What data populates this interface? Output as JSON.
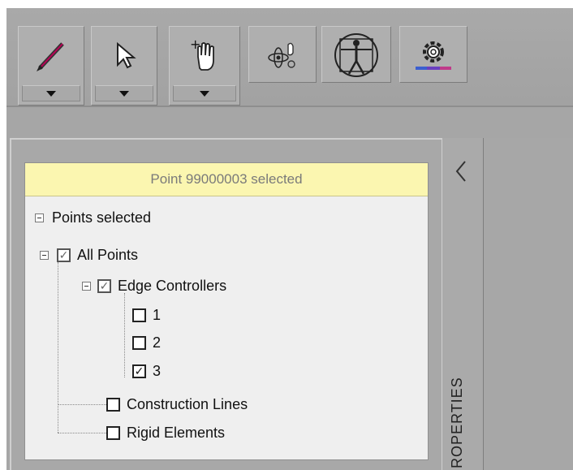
{
  "toolbar": {
    "tools": [
      {
        "icon": "pencil-icon",
        "has_dropdown": true
      },
      {
        "icon": "arrow-pointer-icon",
        "has_dropdown": true
      },
      {
        "icon": "hand-plus-icon",
        "has_dropdown": true
      },
      {
        "icon": "atom-hand-icon",
        "has_dropdown": false
      },
      {
        "icon": "vitruvian-man-icon",
        "has_dropdown": false
      },
      {
        "icon": "gear-icon",
        "has_dropdown": false
      }
    ]
  },
  "panel": {
    "status_text": "Point 99000003 selected",
    "side_tab_label": "PROPERTIES",
    "tree": {
      "root_label": "Points selected",
      "all_points": {
        "label": "All Points",
        "checked": true
      },
      "edge_controllers": {
        "label": "Edge Controllers",
        "checked": true
      },
      "items": [
        {
          "label": "1",
          "checked": false
        },
        {
          "label": "2",
          "checked": false
        },
        {
          "label": "3",
          "checked": true
        }
      ],
      "construction_lines": {
        "label": "Construction Lines",
        "checked": false
      },
      "rigid_elements": {
        "label": "Rigid Elements",
        "checked": false
      }
    }
  },
  "colors": {
    "status_bg": "#fbf6b0",
    "panel_bg": "#efefef",
    "chrome": "#a6a6a6"
  }
}
